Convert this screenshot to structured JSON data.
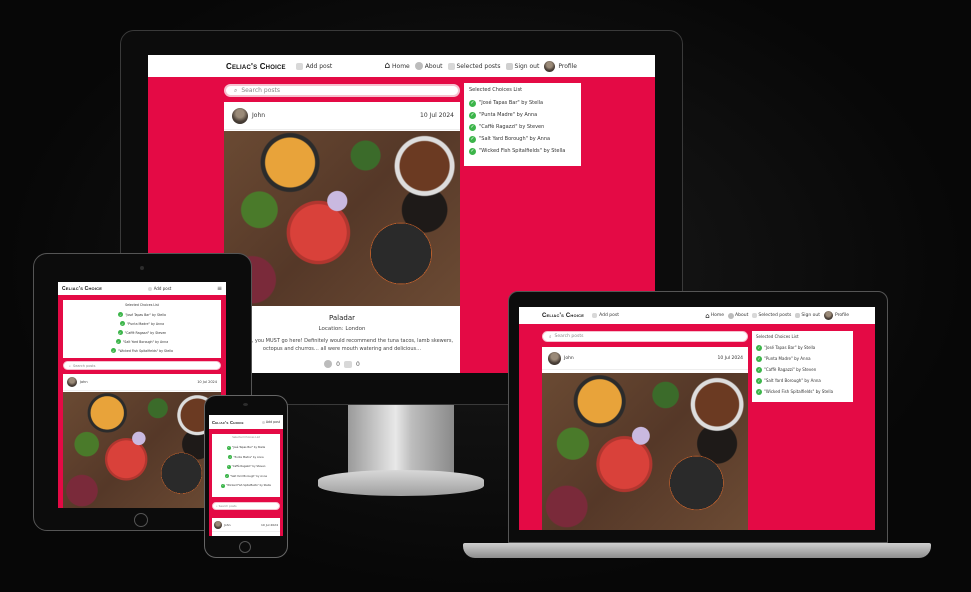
{
  "app": {
    "brand": "Celiac's Choice",
    "add_post": "Add post",
    "nav": {
      "home": "Home",
      "about": "About",
      "selected_posts": "Selected posts",
      "sign_out": "Sign out",
      "profile": "Profile"
    }
  },
  "search": {
    "placeholder": "Search posts"
  },
  "post": {
    "author": "John",
    "date": "10 Jul 2024",
    "title": "Paladar",
    "location": "Location: London",
    "excerpt": "Coeliacs, you MUST go here! Definitely would recommend the tuna tacos, lamb skewers, octopus and churros… all were mouth watering and delicious…",
    "likes": "0",
    "comments": "0"
  },
  "choices": {
    "title": "Selected Choices List",
    "items": [
      "\"José Tapas Bar\" by Stella",
      "\"Punta Madre\" by Anna",
      "\"Caffè Ragazzi\" by Steven",
      "\"Salt Yard Borough\" by Anna",
      "\"Wicked Fish Spitalfields\" by Stella"
    ]
  },
  "colors": {
    "accent": "#e40a45",
    "tick": "#3cb54a",
    "nav_bg": "#ffffff"
  },
  "icons": {
    "home": "home-icon",
    "about": "info-icon",
    "selected": "list-icon",
    "sign_out": "sign-out-icon",
    "profile": "avatar",
    "check": "check-icon",
    "like": "like-icon",
    "comment": "comment-icon"
  }
}
